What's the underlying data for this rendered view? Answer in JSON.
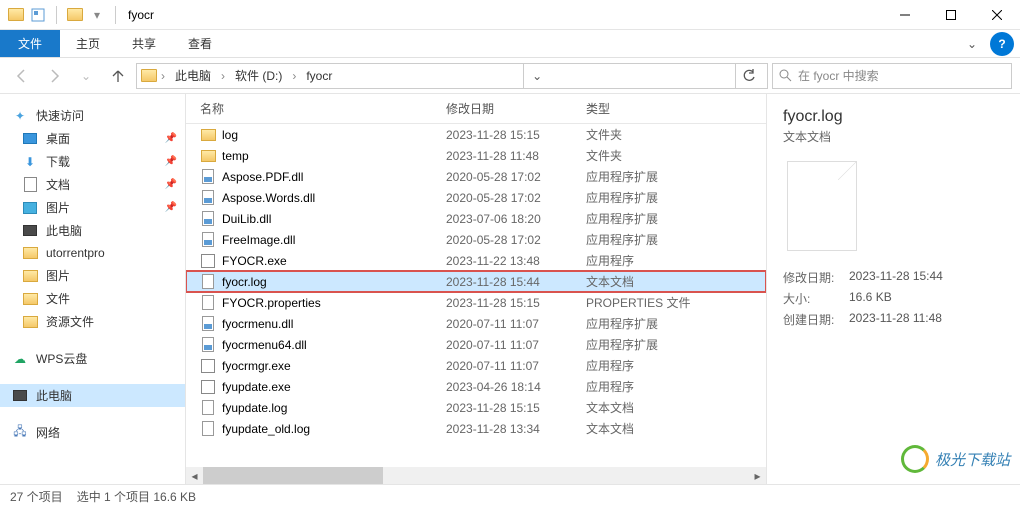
{
  "title": "fyocr",
  "menu": {
    "file": "文件",
    "home": "主页",
    "share": "共享",
    "view": "查看"
  },
  "breadcrumb": {
    "pc": "此电脑",
    "drive": "软件 (D:)",
    "folder": "fyocr"
  },
  "search_placeholder": "在 fyocr 中搜索",
  "sidebar": {
    "quick": {
      "label": "快速访问",
      "items": [
        {
          "label": "桌面",
          "icon": "desktop"
        },
        {
          "label": "下载",
          "icon": "download"
        },
        {
          "label": "文档",
          "icon": "doc"
        },
        {
          "label": "图片",
          "icon": "pic"
        },
        {
          "label": "此电脑",
          "icon": "pc"
        },
        {
          "label": "utorrentpro",
          "icon": "folder"
        },
        {
          "label": "图片",
          "icon": "folder"
        },
        {
          "label": "文件",
          "icon": "folder"
        },
        {
          "label": "资源文件",
          "icon": "folder"
        }
      ]
    },
    "wps": "WPS云盘",
    "thispc": "此电脑",
    "network": "网络"
  },
  "columns": {
    "name": "名称",
    "date": "修改日期",
    "type": "类型"
  },
  "files": [
    {
      "name": "log",
      "date": "2023-11-28 15:15",
      "type": "文件夹",
      "icon": "folder"
    },
    {
      "name": "temp",
      "date": "2023-11-28 11:48",
      "type": "文件夹",
      "icon": "folder"
    },
    {
      "name": "Aspose.PDF.dll",
      "date": "2020-05-28 17:02",
      "type": "应用程序扩展",
      "icon": "dll"
    },
    {
      "name": "Aspose.Words.dll",
      "date": "2020-05-28 17:02",
      "type": "应用程序扩展",
      "icon": "dll"
    },
    {
      "name": "DuiLib.dll",
      "date": "2023-07-06 18:20",
      "type": "应用程序扩展",
      "icon": "dll"
    },
    {
      "name": "FreeImage.dll",
      "date": "2020-05-28 17:02",
      "type": "应用程序扩展",
      "icon": "dll"
    },
    {
      "name": "FYOCR.exe",
      "date": "2023-11-22 13:48",
      "type": "应用程序",
      "icon": "exe"
    },
    {
      "name": "fyocr.log",
      "date": "2023-11-28 15:44",
      "type": "文本文档",
      "icon": "txt",
      "selected": true
    },
    {
      "name": "FYOCR.properties",
      "date": "2023-11-28 15:15",
      "type": "PROPERTIES 文件",
      "icon": "prop"
    },
    {
      "name": "fyocrmenu.dll",
      "date": "2020-07-11 11:07",
      "type": "应用程序扩展",
      "icon": "dll"
    },
    {
      "name": "fyocrmenu64.dll",
      "date": "2020-07-11 11:07",
      "type": "应用程序扩展",
      "icon": "dll"
    },
    {
      "name": "fyocrmgr.exe",
      "date": "2020-07-11 11:07",
      "type": "应用程序",
      "icon": "exe"
    },
    {
      "name": "fyupdate.exe",
      "date": "2023-04-26 18:14",
      "type": "应用程序",
      "icon": "exe"
    },
    {
      "name": "fyupdate.log",
      "date": "2023-11-28 15:15",
      "type": "文本文档",
      "icon": "txt"
    },
    {
      "name": "fyupdate_old.log",
      "date": "2023-11-28 13:34",
      "type": "文本文档",
      "icon": "txt"
    }
  ],
  "details": {
    "name": "fyocr.log",
    "type": "文本文档",
    "meta": [
      {
        "label": "修改日期:",
        "value": "2023-11-28 15:44"
      },
      {
        "label": "大小:",
        "value": "16.6 KB"
      },
      {
        "label": "创建日期:",
        "value": "2023-11-28 11:48"
      }
    ]
  },
  "status": {
    "count": "27 个项目",
    "selection": "选中 1 个项目  16.6 KB"
  },
  "watermark": "极光下载站"
}
